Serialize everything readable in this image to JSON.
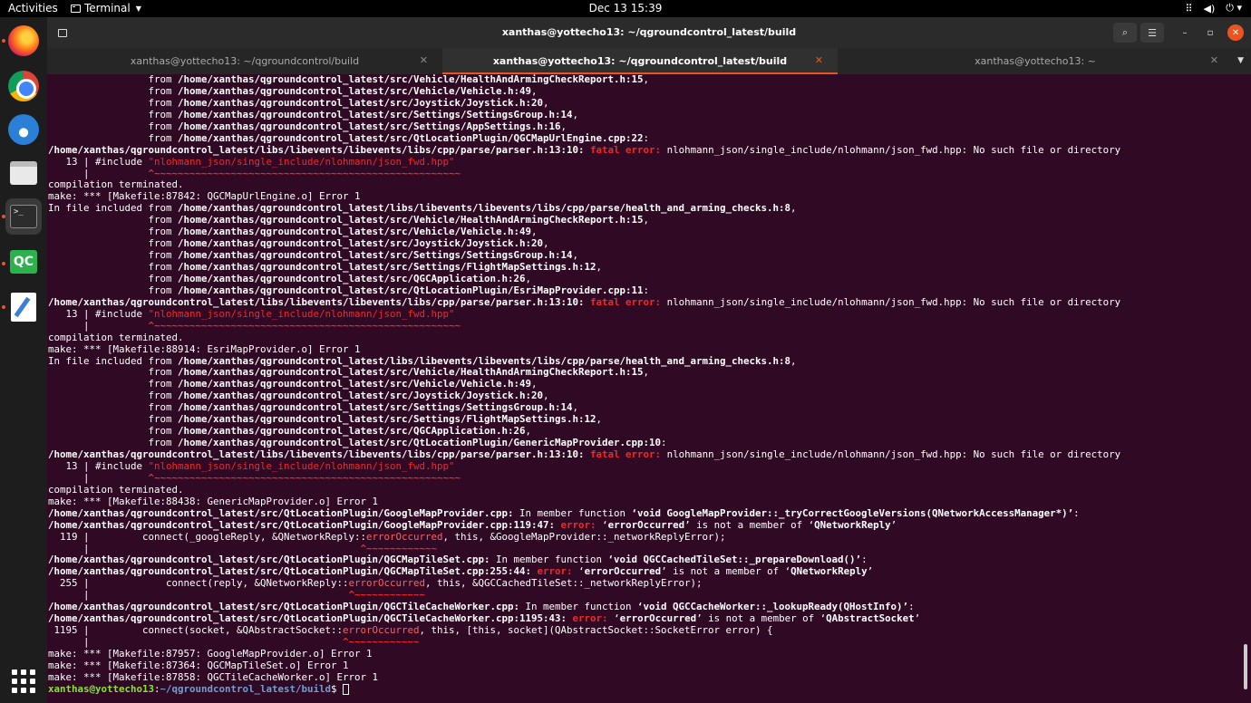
{
  "topbar": {
    "activities": "Activities",
    "app_name": "Terminal",
    "clock": "Dec 13  15:39",
    "tray_icons": [
      "network-icon",
      "volume-icon",
      "power-icon"
    ]
  },
  "dock": {
    "apps": [
      "Firefox",
      "Chrome",
      "Thunderbird",
      "Files",
      "Terminal",
      "QGroundControl",
      "Text Editor"
    ],
    "qgc_label": "QC",
    "terminal_glyph": ">_"
  },
  "window": {
    "title": "xanthas@yottecho13: ~/qgroundcontrol_latest/build",
    "tabs": [
      {
        "label": "xanthas@yottecho13: ~/qgroundcontrol/build",
        "active": false
      },
      {
        "label": "xanthas@yottecho13: ~/qgroundcontrol_latest/build",
        "active": true
      },
      {
        "label": "xanthas@yottecho13: ~",
        "active": false
      }
    ]
  },
  "prompt": {
    "user": "xanthas@yottecho13",
    "path": "~/qgroundcontrol_latest/build"
  },
  "terminal_lines": [
    [
      [
        "                 from ",
        ""
      ],
      [
        "/home/xanthas/qgroundcontrol_latest/src/Vehicle/HealthAndArmingCheckReport.h:15",
        "b"
      ],
      [
        ",",
        ""
      ]
    ],
    [
      [
        "                 from ",
        ""
      ],
      [
        "/home/xanthas/qgroundcontrol_latest/src/Vehicle/Vehicle.h:49",
        "b"
      ],
      [
        ",",
        ""
      ]
    ],
    [
      [
        "                 from ",
        ""
      ],
      [
        "/home/xanthas/qgroundcontrol_latest/src/Joystick/Joystick.h:20",
        "b"
      ],
      [
        ",",
        ""
      ]
    ],
    [
      [
        "                 from ",
        ""
      ],
      [
        "/home/xanthas/qgroundcontrol_latest/src/Settings/SettingsGroup.h:14",
        "b"
      ],
      [
        ",",
        ""
      ]
    ],
    [
      [
        "                 from ",
        ""
      ],
      [
        "/home/xanthas/qgroundcontrol_latest/src/Settings/AppSettings.h:16",
        "b"
      ],
      [
        ",",
        ""
      ]
    ],
    [
      [
        "                 from ",
        ""
      ],
      [
        "/home/xanthas/qgroundcontrol_latest/src/QtLocationPlugin/QGCMapUrlEngine.cpp:22",
        "b"
      ],
      [
        ":",
        ""
      ]
    ],
    [
      [
        "/home/xanthas/qgroundcontrol_latest/libs/libevents/libevents/libs/cpp/parse/parser.h:13:10:",
        "b"
      ],
      [
        " ",
        ""
      ],
      [
        "fatal error:",
        "rb"
      ],
      [
        " nlohmann_json/single_include/nlohmann/json_fwd.hpp: No such file or directory",
        ""
      ]
    ],
    [
      [
        "   13 | #include ",
        ""
      ],
      [
        "\"nlohmann_json/single_include/nlohmann/json_fwd.hpp\"",
        "r"
      ]
    ],
    [
      [
        "      |          ",
        ""
      ],
      [
        "^~~~~~~~~~~~~~~~~~~~~~~~~~~~~~~~~~~~~~~~~~~~~~~~~~~~~",
        "rb"
      ]
    ],
    [
      [
        "compilation terminated.",
        ""
      ]
    ],
    [
      [
        "make: *** [Makefile:87842: QGCMapUrlEngine.o] Error 1",
        ""
      ]
    ],
    [
      [
        "In file included from ",
        ""
      ],
      [
        "/home/xanthas/qgroundcontrol_latest/libs/libevents/libevents/libs/cpp/parse/health_and_arming_checks.h:8",
        "b"
      ],
      [
        ",",
        ""
      ]
    ],
    [
      [
        "                 from ",
        ""
      ],
      [
        "/home/xanthas/qgroundcontrol_latest/src/Vehicle/HealthAndArmingCheckReport.h:15",
        "b"
      ],
      [
        ",",
        ""
      ]
    ],
    [
      [
        "                 from ",
        ""
      ],
      [
        "/home/xanthas/qgroundcontrol_latest/src/Vehicle/Vehicle.h:49",
        "b"
      ],
      [
        ",",
        ""
      ]
    ],
    [
      [
        "                 from ",
        ""
      ],
      [
        "/home/xanthas/qgroundcontrol_latest/src/Joystick/Joystick.h:20",
        "b"
      ],
      [
        ",",
        ""
      ]
    ],
    [
      [
        "                 from ",
        ""
      ],
      [
        "/home/xanthas/qgroundcontrol_latest/src/Settings/SettingsGroup.h:14",
        "b"
      ],
      [
        ",",
        ""
      ]
    ],
    [
      [
        "                 from ",
        ""
      ],
      [
        "/home/xanthas/qgroundcontrol_latest/src/Settings/FlightMapSettings.h:12",
        "b"
      ],
      [
        ",",
        ""
      ]
    ],
    [
      [
        "                 from ",
        ""
      ],
      [
        "/home/xanthas/qgroundcontrol_latest/src/QGCApplication.h:26",
        "b"
      ],
      [
        ",",
        ""
      ]
    ],
    [
      [
        "                 from ",
        ""
      ],
      [
        "/home/xanthas/qgroundcontrol_latest/src/QtLocationPlugin/EsriMapProvider.cpp:11",
        "b"
      ],
      [
        ":",
        ""
      ]
    ],
    [
      [
        "/home/xanthas/qgroundcontrol_latest/libs/libevents/libevents/libs/cpp/parse/parser.h:13:10:",
        "b"
      ],
      [
        " ",
        ""
      ],
      [
        "fatal error:",
        "rb"
      ],
      [
        " nlohmann_json/single_include/nlohmann/json_fwd.hpp: No such file or directory",
        ""
      ]
    ],
    [
      [
        "   13 | #include ",
        ""
      ],
      [
        "\"nlohmann_json/single_include/nlohmann/json_fwd.hpp\"",
        "r"
      ]
    ],
    [
      [
        "      |          ",
        ""
      ],
      [
        "^~~~~~~~~~~~~~~~~~~~~~~~~~~~~~~~~~~~~~~~~~~~~~~~~~~~~",
        "rb"
      ]
    ],
    [
      [
        "compilation terminated.",
        ""
      ]
    ],
    [
      [
        "make: *** [Makefile:88914: EsriMapProvider.o] Error 1",
        ""
      ]
    ],
    [
      [
        "In file included from ",
        ""
      ],
      [
        "/home/xanthas/qgroundcontrol_latest/libs/libevents/libevents/libs/cpp/parse/health_and_arming_checks.h:8",
        "b"
      ],
      [
        ",",
        ""
      ]
    ],
    [
      [
        "                 from ",
        ""
      ],
      [
        "/home/xanthas/qgroundcontrol_latest/src/Vehicle/HealthAndArmingCheckReport.h:15",
        "b"
      ],
      [
        ",",
        ""
      ]
    ],
    [
      [
        "                 from ",
        ""
      ],
      [
        "/home/xanthas/qgroundcontrol_latest/src/Vehicle/Vehicle.h:49",
        "b"
      ],
      [
        ",",
        ""
      ]
    ],
    [
      [
        "                 from ",
        ""
      ],
      [
        "/home/xanthas/qgroundcontrol_latest/src/Joystick/Joystick.h:20",
        "b"
      ],
      [
        ",",
        ""
      ]
    ],
    [
      [
        "                 from ",
        ""
      ],
      [
        "/home/xanthas/qgroundcontrol_latest/src/Settings/SettingsGroup.h:14",
        "b"
      ],
      [
        ",",
        ""
      ]
    ],
    [
      [
        "                 from ",
        ""
      ],
      [
        "/home/xanthas/qgroundcontrol_latest/src/Settings/FlightMapSettings.h:12",
        "b"
      ],
      [
        ",",
        ""
      ]
    ],
    [
      [
        "                 from ",
        ""
      ],
      [
        "/home/xanthas/qgroundcontrol_latest/src/QGCApplication.h:26",
        "b"
      ],
      [
        ",",
        ""
      ]
    ],
    [
      [
        "                 from ",
        ""
      ],
      [
        "/home/xanthas/qgroundcontrol_latest/src/QtLocationPlugin/GenericMapProvider.cpp:10",
        "b"
      ],
      [
        ":",
        ""
      ]
    ],
    [
      [
        "/home/xanthas/qgroundcontrol_latest/libs/libevents/libevents/libs/cpp/parse/parser.h:13:10:",
        "b"
      ],
      [
        " ",
        ""
      ],
      [
        "fatal error:",
        "rb"
      ],
      [
        " nlohmann_json/single_include/nlohmann/json_fwd.hpp: No such file or directory",
        ""
      ]
    ],
    [
      [
        "   13 | #include ",
        ""
      ],
      [
        "\"nlohmann_json/single_include/nlohmann/json_fwd.hpp\"",
        "r"
      ]
    ],
    [
      [
        "      |          ",
        ""
      ],
      [
        "^~~~~~~~~~~~~~~~~~~~~~~~~~~~~~~~~~~~~~~~~~~~~~~~~~~~~",
        "rb"
      ]
    ],
    [
      [
        "compilation terminated.",
        ""
      ]
    ],
    [
      [
        "make: *** [Makefile:88438: GenericMapProvider.o] Error 1",
        ""
      ]
    ],
    [
      [
        "/home/xanthas/qgroundcontrol_latest/src/QtLocationPlugin/GoogleMapProvider.cpp:",
        "b"
      ],
      [
        " In member function ",
        ""
      ],
      [
        "‘void GoogleMapProvider::_tryCorrectGoogleVersions(QNetworkAccessManager*)’",
        "b"
      ],
      [
        ":",
        ""
      ]
    ],
    [
      [
        "/home/xanthas/qgroundcontrol_latest/src/QtLocationPlugin/GoogleMapProvider.cpp:119:47:",
        "b"
      ],
      [
        " ",
        ""
      ],
      [
        "error:",
        "rb"
      ],
      [
        " ‘",
        ""
      ],
      [
        "errorOccurred",
        "b"
      ],
      [
        "’ is not a member of ‘",
        ""
      ],
      [
        "QNetworkReply",
        "b"
      ],
      [
        "’",
        ""
      ]
    ],
    [
      [
        "  119 |         connect(_googleReply, &QNetworkReply::",
        ""
      ],
      [
        "errorOccurred",
        "m"
      ],
      [
        ", this, &GoogleMapProvider::_networkReplyError);",
        ""
      ]
    ],
    [
      [
        "      |                                              ",
        ""
      ],
      [
        "^~~~~~~~~~~~~",
        "rb"
      ]
    ],
    [
      [
        "/home/xanthas/qgroundcontrol_latest/src/QtLocationPlugin/QGCMapTileSet.cpp:",
        "b"
      ],
      [
        " In member function ",
        ""
      ],
      [
        "‘void QGCCachedTileSet::_prepareDownload()’",
        "b"
      ],
      [
        ":",
        ""
      ]
    ],
    [
      [
        "/home/xanthas/qgroundcontrol_latest/src/QtLocationPlugin/QGCMapTileSet.cpp:255:44:",
        "b"
      ],
      [
        " ",
        ""
      ],
      [
        "error:",
        "rb"
      ],
      [
        " ‘",
        ""
      ],
      [
        "errorOccurred",
        "b"
      ],
      [
        "’ is not a member of ‘",
        ""
      ],
      [
        "QNetworkReply",
        "b"
      ],
      [
        "’",
        ""
      ]
    ],
    [
      [
        "  255 |             connect(reply, &QNetworkReply::",
        ""
      ],
      [
        "errorOccurred",
        "m"
      ],
      [
        ", this, &QGCCachedTileSet::_networkReplyError);",
        ""
      ]
    ],
    [
      [
        "      |                                            ",
        ""
      ],
      [
        "^~~~~~~~~~~~~",
        "rb"
      ]
    ],
    [
      [
        "/home/xanthas/qgroundcontrol_latest/src/QtLocationPlugin/QGCTileCacheWorker.cpp:",
        "b"
      ],
      [
        " In member function ",
        ""
      ],
      [
        "‘void QGCCacheWorker::_lookupReady(QHostInfo)’",
        "b"
      ],
      [
        ":",
        ""
      ]
    ],
    [
      [
        "/home/xanthas/qgroundcontrol_latest/src/QtLocationPlugin/QGCTileCacheWorker.cpp:1195:43:",
        "b"
      ],
      [
        " ",
        ""
      ],
      [
        "error:",
        "rb"
      ],
      [
        " ‘",
        ""
      ],
      [
        "errorOccurred",
        "b"
      ],
      [
        "’ is not a member of ‘",
        ""
      ],
      [
        "QAbstractSocket",
        "b"
      ],
      [
        "’",
        ""
      ]
    ],
    [
      [
        " 1195 |         connect(socket, &QAbstractSocket::",
        ""
      ],
      [
        "errorOccurred",
        "m"
      ],
      [
        ", this, [this, socket](QAbstractSocket::SocketError error) {",
        ""
      ]
    ],
    [
      [
        "      |                                           ",
        ""
      ],
      [
        "^~~~~~~~~~~~~",
        "rb"
      ]
    ],
    [
      [
        "make: *** [Makefile:87957: GoogleMapProvider.o] Error 1",
        ""
      ]
    ],
    [
      [
        "make: *** [Makefile:87364: QGCMapTileSet.o] Error 1",
        ""
      ]
    ],
    [
      [
        "make: *** [Makefile:87858: QGCTileCacheWorker.o] Error 1",
        ""
      ]
    ]
  ]
}
